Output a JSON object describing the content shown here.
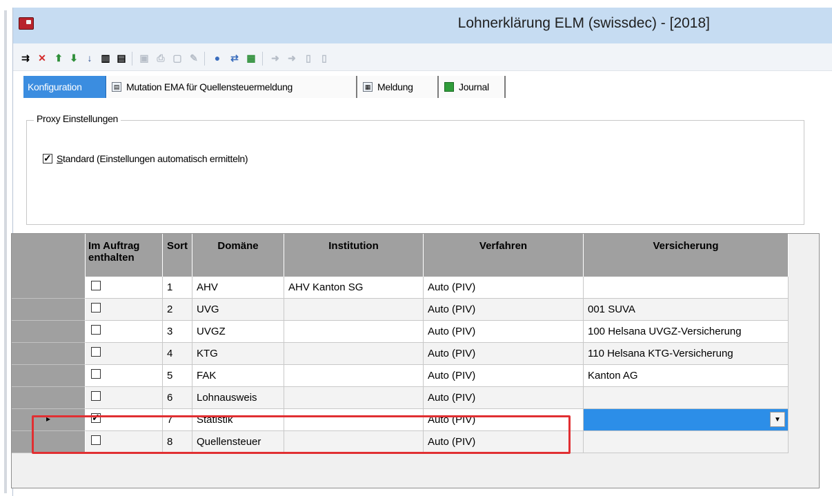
{
  "window": {
    "title": "Lohnerklärung ELM (swissdec) - [2018]"
  },
  "toolbar": {
    "buttons": [
      {
        "name": "insert-record-icon",
        "glyph": "⇉"
      },
      {
        "name": "delete-record-icon",
        "glyph": "✕"
      },
      {
        "name": "move-up-icon",
        "glyph": "⬆"
      },
      {
        "name": "move-down-icon",
        "glyph": "⬇"
      },
      {
        "name": "sort-az-icon",
        "glyph": "↓"
      },
      {
        "name": "list-view-icon",
        "glyph": "▥"
      },
      {
        "name": "details-view-icon",
        "glyph": "▤"
      },
      {
        "name": "copy-icon",
        "glyph": "▣"
      },
      {
        "name": "print-icon",
        "glyph": "⎙"
      },
      {
        "name": "save-icon",
        "glyph": "▢"
      },
      {
        "name": "edit-icon",
        "glyph": "✎"
      },
      {
        "name": "users-icon",
        "glyph": "●"
      },
      {
        "name": "transfer-icon",
        "glyph": "⇄"
      },
      {
        "name": "certificate-icon",
        "glyph": "▦"
      },
      {
        "name": "forward-icon",
        "glyph": "➜"
      },
      {
        "name": "forward-all-icon",
        "glyph": "➜"
      },
      {
        "name": "document-icon",
        "glyph": "▯"
      },
      {
        "name": "documents-icon",
        "glyph": "▯"
      }
    ]
  },
  "tabs": [
    {
      "label": "Konfiguration"
    },
    {
      "label": "Mutation EMA für Quellensteuermeldung"
    },
    {
      "label": "Meldung"
    },
    {
      "label": "Journal"
    }
  ],
  "proxy": {
    "legend": "Proxy Einstellungen",
    "checkbox_label_underlined": "S",
    "checkbox_label_rest": "tandard (Einstellungen automatisch ermitteln)",
    "checked": true
  },
  "grid": {
    "columns": [
      {
        "label": "Im Auftrag enthalten"
      },
      {
        "label": "Sort"
      },
      {
        "label": "Domäne"
      },
      {
        "label": "Institution"
      },
      {
        "label": "Verfahren"
      },
      {
        "label": "Versicherung"
      }
    ],
    "rows": [
      {
        "included": false,
        "sort": "1",
        "domain": "AHV",
        "institution": "AHV Kanton SG",
        "procedure": "Auto (PIV)",
        "insurance": ""
      },
      {
        "included": false,
        "sort": "2",
        "domain": "UVG",
        "institution": "",
        "procedure": "Auto (PIV)",
        "insurance": "001 SUVA"
      },
      {
        "included": false,
        "sort": "3",
        "domain": "UVGZ",
        "institution": "",
        "procedure": "Auto (PIV)",
        "insurance": "100 Helsana UVGZ-Versicherung"
      },
      {
        "included": false,
        "sort": "4",
        "domain": "KTG",
        "institution": "",
        "procedure": "Auto (PIV)",
        "insurance": "110 Helsana KTG-Versicherung"
      },
      {
        "included": false,
        "sort": "5",
        "domain": "FAK",
        "institution": "",
        "procedure": "Auto (PIV)",
        "insurance": "Kanton AG"
      },
      {
        "included": false,
        "sort": "6",
        "domain": "Lohnausweis",
        "institution": "",
        "procedure": "Auto (PIV)",
        "insurance": ""
      },
      {
        "included": true,
        "sort": "7",
        "domain": "Statistik",
        "institution": "",
        "procedure": "Auto (PIV)",
        "insurance": "",
        "current": true
      },
      {
        "included": false,
        "sort": "8",
        "domain": "Quellensteuer",
        "institution": "",
        "procedure": "Auto (PIV)",
        "insurance": ""
      }
    ],
    "current_row_marker": "▸"
  },
  "colors": {
    "title_bar": "#c6dcf2",
    "active_tab": "#3b8de0",
    "grid_header": "#a0a0a0",
    "selected_dropdown": "#2c8ee8",
    "highlight_box": "#e12f32"
  }
}
